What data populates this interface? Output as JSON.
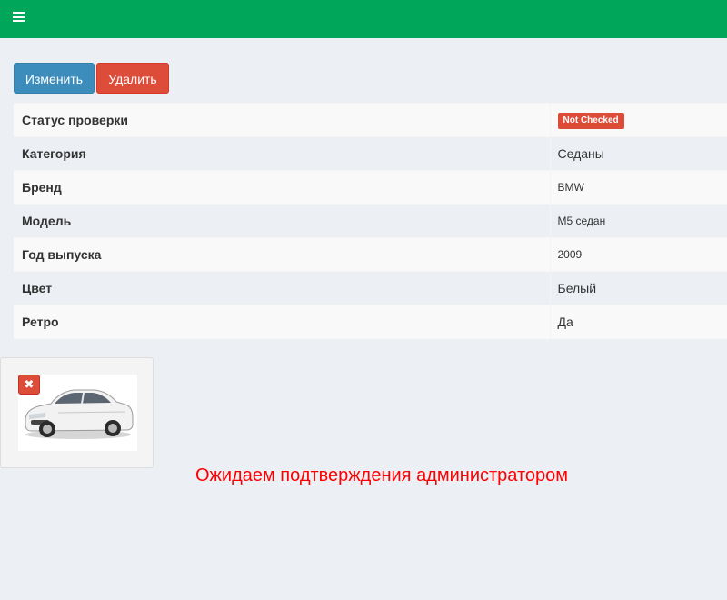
{
  "topbar": {
    "menu_icon": "hamburger-icon",
    "color": "#00a65a"
  },
  "actions": {
    "edit_label": "Изменить",
    "delete_label": "Удалить"
  },
  "details": [
    {
      "label": "Статус проверки",
      "value": "Not Checked",
      "type": "badge"
    },
    {
      "label": "Категория",
      "value": "Седаны"
    },
    {
      "label": "Бренд",
      "value": "BMW"
    },
    {
      "label": "Модель",
      "value": "M5 седан"
    },
    {
      "label": "Год выпуска",
      "value": "2009"
    },
    {
      "label": "Цвет",
      "value": "Белый"
    },
    {
      "label": "Ретро",
      "value": "Да"
    }
  ],
  "photo": {
    "remove_icon": "close-icon",
    "remove_glyph": "✖",
    "image": "white-sedan-car"
  },
  "pending_message": "Ожидаем подтверждения администратором",
  "colors": {
    "primary": "#3c8dbc",
    "danger": "#dd4b39",
    "background": "#ecf0f5",
    "pending_text": "#ff0000"
  }
}
